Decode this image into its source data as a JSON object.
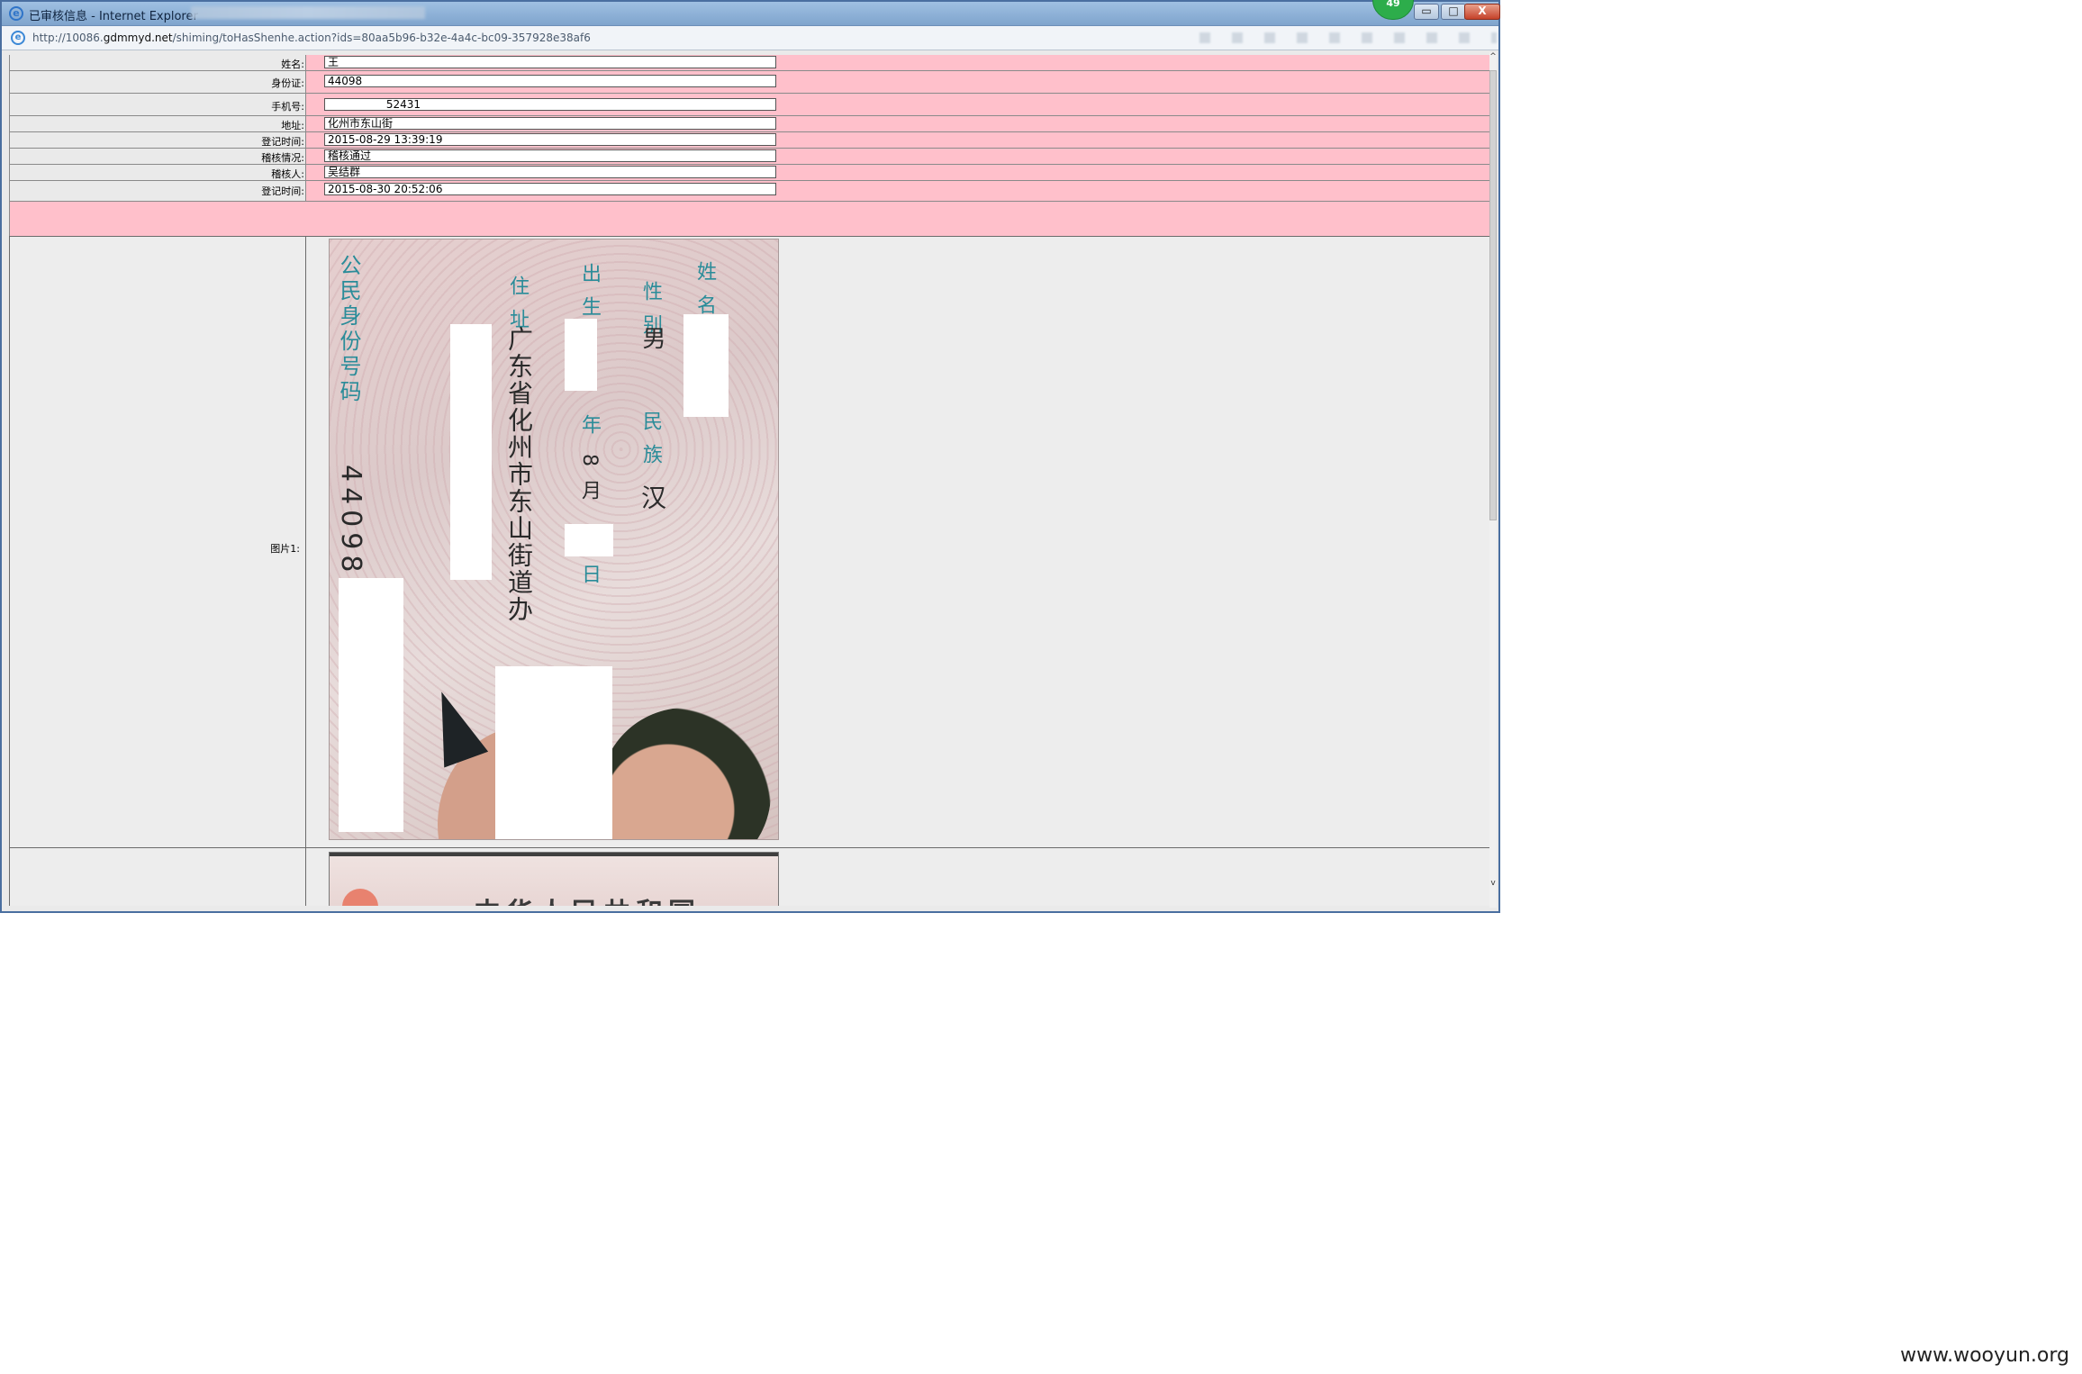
{
  "window": {
    "title": "已审核信息 - Internet Explorer",
    "badge": "49",
    "minimize": "▭",
    "maximize": "□",
    "close": "X"
  },
  "address": {
    "url_prefix": "http://10086.",
    "url_domain": "gdmmyd.net",
    "url_path": "/shiming/toHasShenhe.action?ids=80aa5b96-b32e-4a4c-bc09-357928e38af6"
  },
  "form": [
    {
      "label": "姓名:",
      "value": "王"
    },
    {
      "label": "身份证:",
      "value": "44098"
    },
    {
      "label": "手机号:",
      "value": "                 52431"
    },
    {
      "label": "地址:",
      "value": "化州市东山街"
    },
    {
      "label": "登记时间:",
      "value": "2015-08-29 13:39:19"
    },
    {
      "label": "稽核情况:",
      "value": "稽核通过"
    },
    {
      "label": "稽核人:",
      "value": "吴结群"
    },
    {
      "label": "登记时间:",
      "value": "2015-08-30 20:52:06"
    }
  ],
  "images": {
    "label_1": "图片1:",
    "card": {
      "name_label": "姓  名",
      "sex_label": "性  别",
      "sex_value": "男",
      "ethnicity_label": "民  族",
      "ethnicity_value": "汉",
      "birth_label": "出  生",
      "birth_year": "年",
      "birth_month": "8  月",
      "birth_day": "日",
      "address_label": "住  址",
      "address_value": "广东省化州市东山街道办",
      "id_label": "公民身份号码",
      "id_value": "44098"
    },
    "card2_text": "中华人民共和国"
  },
  "scroll": {
    "up": "^",
    "down": "v"
  },
  "watermark": "www.wooyun.org"
}
